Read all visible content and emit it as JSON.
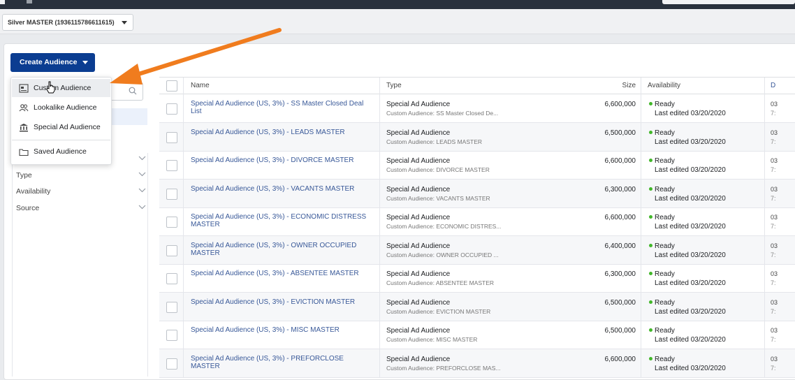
{
  "account": {
    "name": "Silver MASTER (1936115786611615)"
  },
  "create_button": {
    "label": "Create Audience"
  },
  "dropdown": {
    "items": [
      {
        "label": "Custom Audience",
        "icon": "custom-audience-icon",
        "highlighted": true
      },
      {
        "label": "Lookalike Audience",
        "icon": "people-icon",
        "highlighted": false
      },
      {
        "label": "Special Ad Audience",
        "icon": "bank-icon",
        "highlighted": false
      },
      {
        "label": "Saved Audience",
        "icon": "folder-icon",
        "highlighted": false
      }
    ]
  },
  "filters": {
    "items": [
      {
        "label": ""
      },
      {
        "label": "Type"
      },
      {
        "label": "Availability"
      },
      {
        "label": "Source"
      }
    ]
  },
  "table": {
    "headers": {
      "name": "Name",
      "type": "Type",
      "size": "Size",
      "availability": "Availability",
      "date": "D"
    },
    "rows": [
      {
        "name": "Special Ad Audience (US, 3%) - SS Master Closed Deal List",
        "type": "Special Ad Audience",
        "subtype": "Custom Audience: SS Master Closed De...",
        "size": "6,600,000",
        "status": "Ready",
        "edited": "Last edited 03/20/2020",
        "d1": "03",
        "d2": "7:"
      },
      {
        "name": "Special Ad Audience (US, 3%) - LEADS MASTER",
        "type": "Special Ad Audience",
        "subtype": "Custom Audience: LEADS MASTER",
        "size": "6,500,000",
        "status": "Ready",
        "edited": "Last edited 03/20/2020",
        "d1": "03",
        "d2": "7:"
      },
      {
        "name": "Special Ad Audience (US, 3%) - DIVORCE MASTER",
        "type": "Special Ad Audience",
        "subtype": "Custom Audience: DIVORCE MASTER",
        "size": "6,600,000",
        "status": "Ready",
        "edited": "Last edited 03/20/2020",
        "d1": "03",
        "d2": "7:"
      },
      {
        "name": "Special Ad Audience (US, 3%) - VACANTS MASTER",
        "type": "Special Ad Audience",
        "subtype": "Custom Audience: VACANTS MASTER",
        "size": "6,300,000",
        "status": "Ready",
        "edited": "Last edited 03/20/2020",
        "d1": "03",
        "d2": "7:"
      },
      {
        "name": "Special Ad Audience (US, 3%) - ECONOMIC DISTRESS MASTER",
        "type": "Special Ad Audience",
        "subtype": "Custom Audience: ECONOMIC DISTRES...",
        "size": "6,600,000",
        "status": "Ready",
        "edited": "Last edited 03/20/2020",
        "d1": "03",
        "d2": "7:"
      },
      {
        "name": "Special Ad Audience (US, 3%) - OWNER OCCUPIED MASTER",
        "type": "Special Ad Audience",
        "subtype": "Custom Audience: OWNER OCCUPIED ...",
        "size": "6,400,000",
        "status": "Ready",
        "edited": "Last edited 03/20/2020",
        "d1": "03",
        "d2": "7:"
      },
      {
        "name": "Special Ad Audience (US, 3%) - ABSENTEE MASTER",
        "type": "Special Ad Audience",
        "subtype": "Custom Audience: ABSENTEE MASTER",
        "size": "6,300,000",
        "status": "Ready",
        "edited": "Last edited 03/20/2020",
        "d1": "03",
        "d2": "7:"
      },
      {
        "name": "Special Ad Audience (US, 3%) - EVICTION MASTER",
        "type": "Special Ad Audience",
        "subtype": "Custom Audience: EVICTION MASTER",
        "size": "6,500,000",
        "status": "Ready",
        "edited": "Last edited 03/20/2020",
        "d1": "03",
        "d2": "7:"
      },
      {
        "name": "Special Ad Audience (US, 3%) - MISC MASTER",
        "type": "Special Ad Audience",
        "subtype": "Custom Audience: MISC MASTER",
        "size": "6,500,000",
        "status": "Ready",
        "edited": "Last edited 03/20/2020",
        "d1": "03",
        "d2": "7:"
      },
      {
        "name": "Special Ad Audience (US, 3%) - PREFORCLOSE MASTER",
        "type": "Special Ad Audience",
        "subtype": "Custom Audience: PREFORCLOSE MAS...",
        "size": "6,600,000",
        "status": "Ready",
        "edited": "Last edited 03/20/2020",
        "d1": "03",
        "d2": "7:"
      }
    ]
  },
  "colors": {
    "primary": "#0b3d91",
    "link": "#385898",
    "ready": "#42b72a",
    "annotation_arrow": "#f07c1e"
  }
}
